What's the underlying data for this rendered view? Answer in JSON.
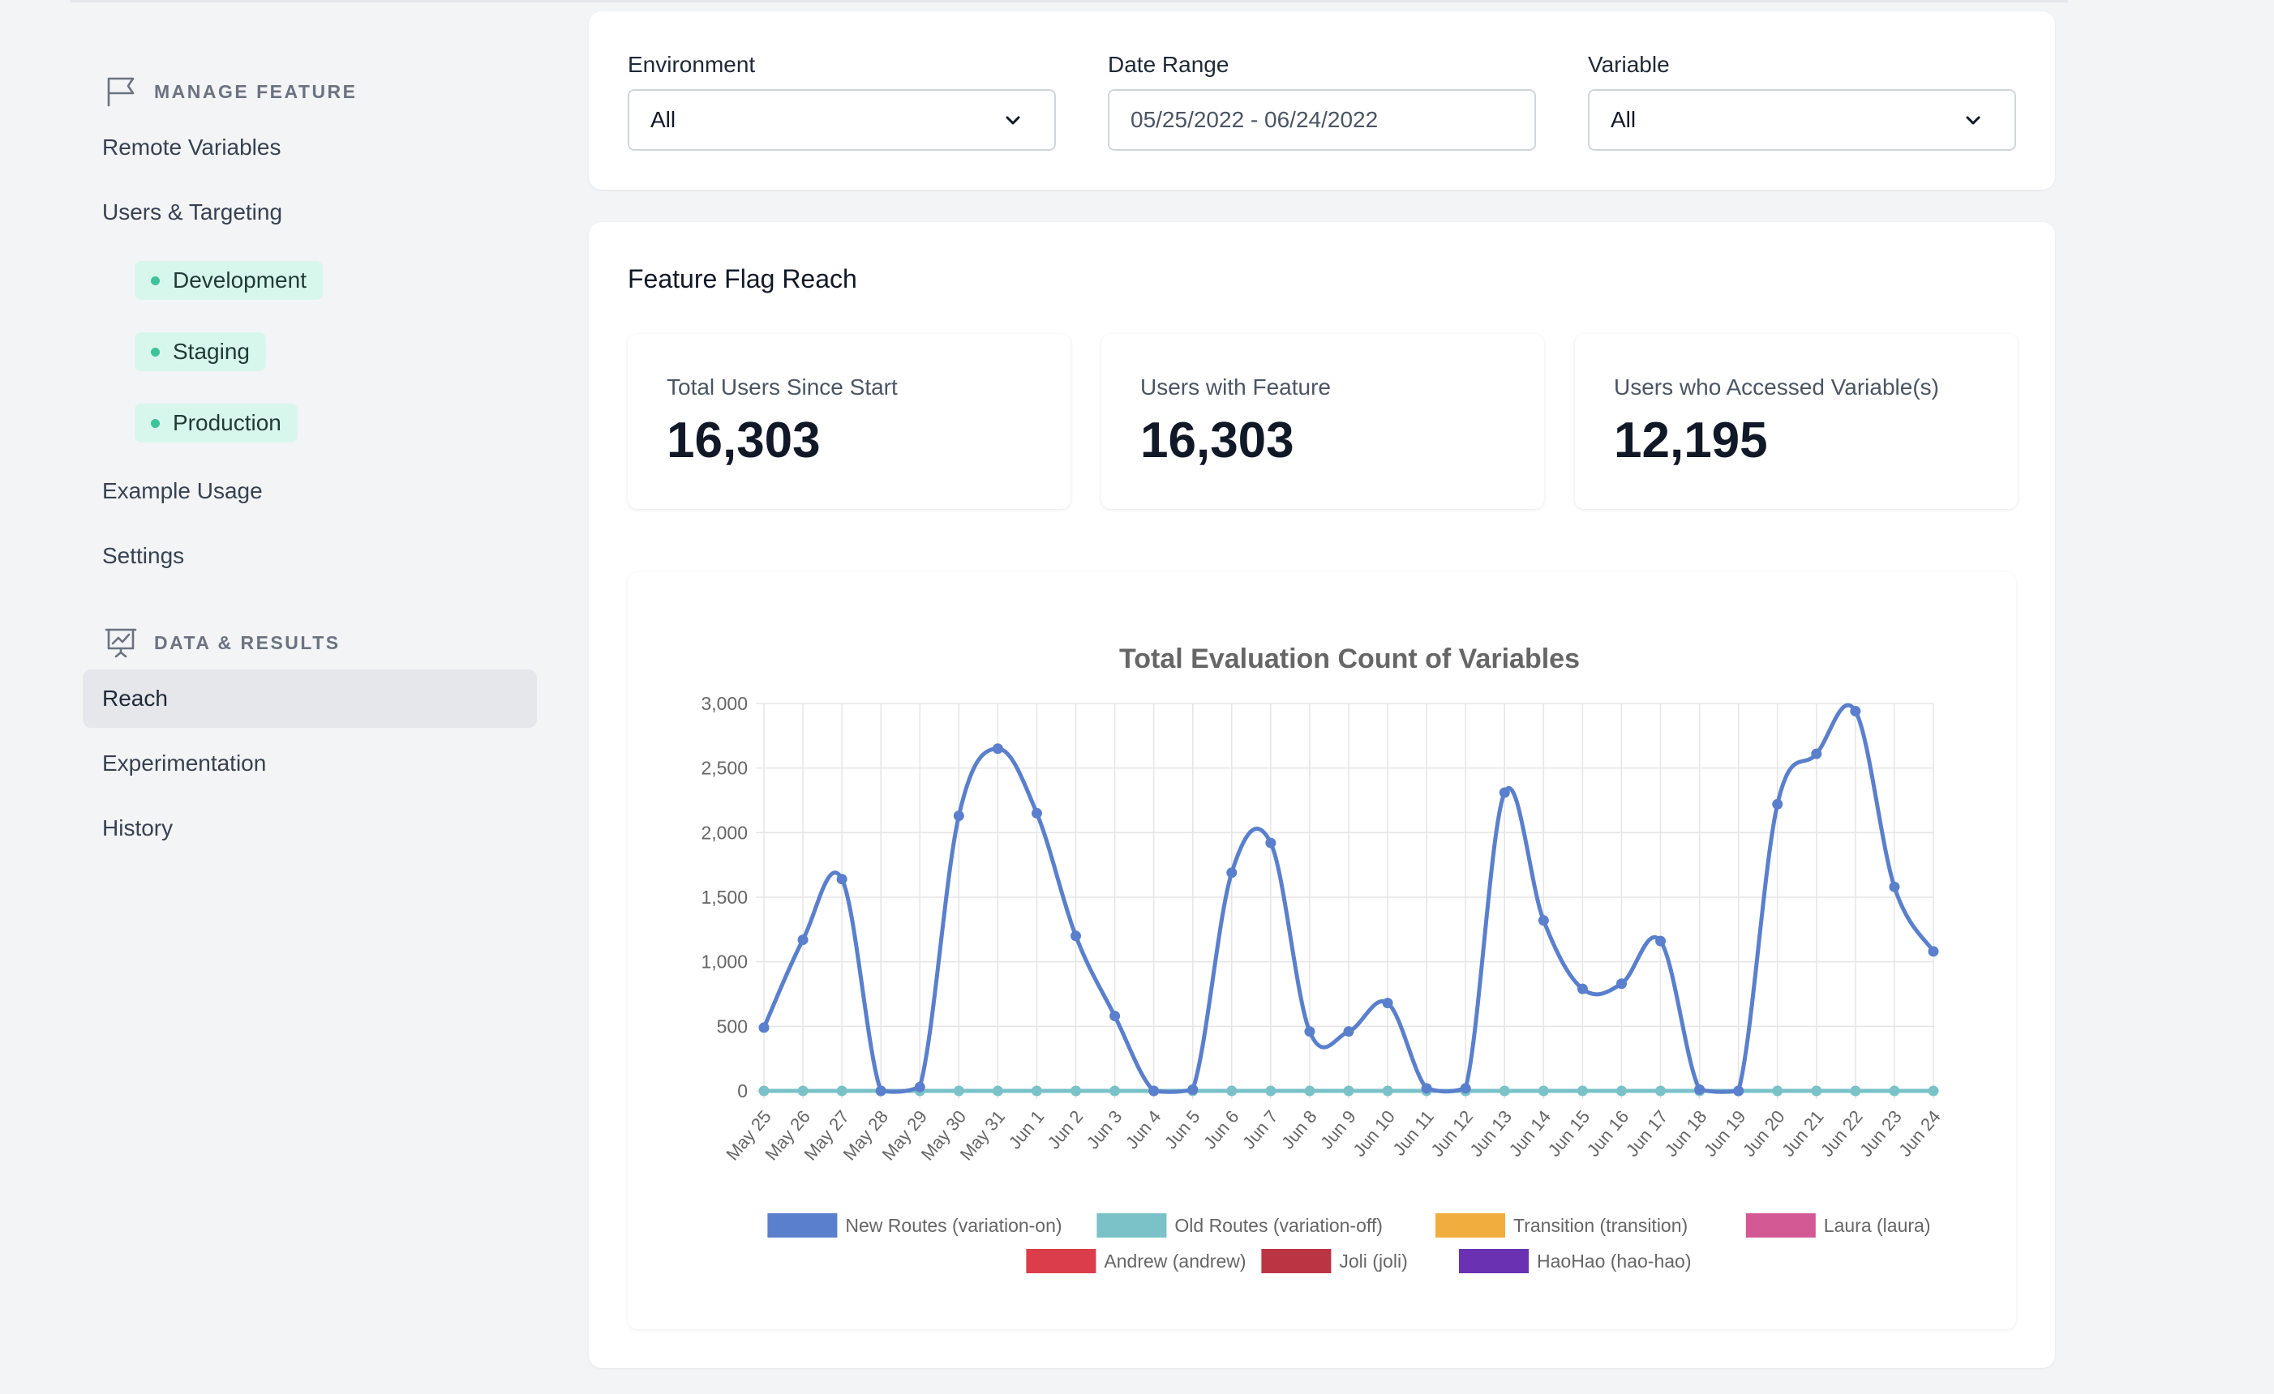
{
  "sidebar": {
    "manage_title": "MANAGE FEATURE",
    "manage_items": [
      "Remote Variables",
      "Users & Targeting"
    ],
    "environments": [
      "Development",
      "Staging",
      "Production"
    ],
    "manage_items_after": [
      "Example Usage",
      "Settings"
    ],
    "data_title": "DATA & RESULTS",
    "data_items": [
      "Reach",
      "Experimentation",
      "History"
    ],
    "active_item": "Reach"
  },
  "filters": {
    "environment_label": "Environment",
    "environment_value": "All",
    "date_label": "Date Range",
    "date_value": "05/25/2022 - 06/24/2022",
    "variable_label": "Variable",
    "variable_value": "All"
  },
  "reach": {
    "title": "Feature Flag Reach",
    "stats": [
      {
        "label": "Total Users Since Start",
        "value": "16,303"
      },
      {
        "label": "Users with Feature",
        "value": "16,303"
      },
      {
        "label": "Users who Accessed Variable(s)",
        "value": "12,195"
      }
    ]
  },
  "chart_data": {
    "type": "line",
    "title": "Total Evaluation Count of Variables",
    "xlabel": "",
    "ylabel": "",
    "ylim": [
      0,
      3000
    ],
    "yticks": [
      "0",
      "500",
      "1,000",
      "1,500",
      "2,000",
      "2,500",
      "3,000"
    ],
    "x": [
      "May 25",
      "May 26",
      "May 27",
      "May 28",
      "May 29",
      "May 30",
      "May 31",
      "Jun 1",
      "Jun 2",
      "Jun 3",
      "Jun 4",
      "Jun 5",
      "Jun 6",
      "Jun 7",
      "Jun 8",
      "Jun 9",
      "Jun 10",
      "Jun 11",
      "Jun 12",
      "Jun 13",
      "Jun 14",
      "Jun 15",
      "Jun 16",
      "Jun 17",
      "Jun 18",
      "Jun 19",
      "Jun 20",
      "Jun 21",
      "Jun 22",
      "Jun 23",
      "Jun 24"
    ],
    "grid": true,
    "legend_position": "bottom",
    "series": [
      {
        "name": "New Routes (variation-on)",
        "color": "#5a7fcc",
        "values": [
          490,
          1170,
          1640,
          0,
          30,
          2130,
          2650,
          2150,
          1200,
          580,
          0,
          10,
          1690,
          1920,
          460,
          460,
          680,
          20,
          20,
          2310,
          1320,
          790,
          830,
          1160,
          10,
          0,
          2220,
          2610,
          2940,
          1580,
          1080
        ]
      },
      {
        "name": "Old Routes (variation-off)",
        "color": "#7ac2c8",
        "values": [
          0,
          0,
          0,
          0,
          0,
          0,
          0,
          0,
          0,
          0,
          0,
          0,
          0,
          0,
          0,
          0,
          0,
          0,
          0,
          0,
          0,
          0,
          0,
          0,
          0,
          0,
          0,
          0,
          0,
          0,
          0
        ]
      },
      {
        "name": "Transition (transition)",
        "color": "#f2ad3f",
        "values": []
      },
      {
        "name": "Laura (laura)",
        "color": "#d25994",
        "values": []
      },
      {
        "name": "Andrew (andrew)",
        "color": "#dc3d4b",
        "values": []
      },
      {
        "name": "Joli (joli)",
        "color": "#bb3444",
        "values": []
      },
      {
        "name": "HaoHao (hao-hao)",
        "color": "#6a31b2",
        "values": []
      }
    ]
  }
}
